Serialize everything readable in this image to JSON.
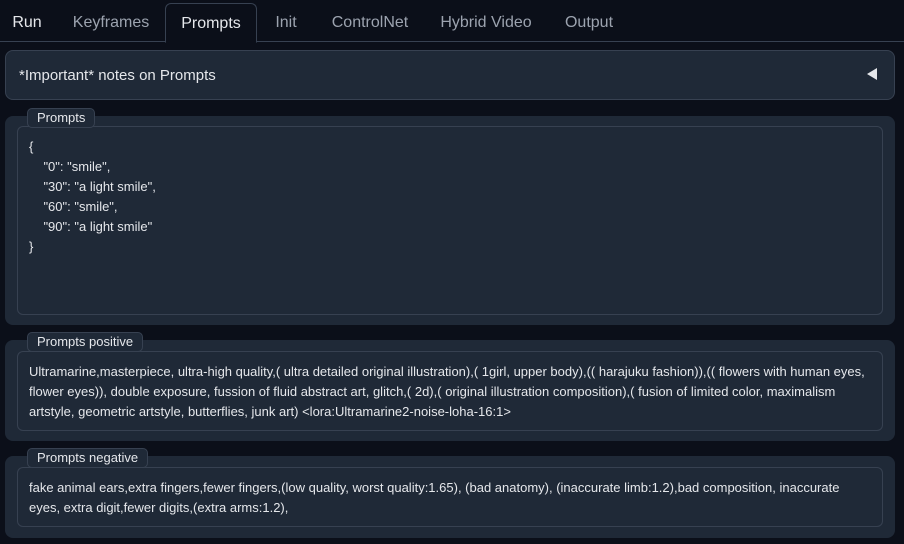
{
  "tabs": [
    {
      "label": "Run"
    },
    {
      "label": "Keyframes"
    },
    {
      "label": "Prompts",
      "selected": true
    },
    {
      "label": "Init"
    },
    {
      "label": "ControlNet"
    },
    {
      "label": "Hybrid Video"
    },
    {
      "label": "Output"
    }
  ],
  "accordion": {
    "label": "*Important* notes on Prompts",
    "icon": "triangle-left-icon"
  },
  "prompts": {
    "label": "Prompts",
    "lines": [
      "{",
      "    \"0\": \"smile\",",
      "    \"30\": \"a light smile\",",
      "    \"60\": \"smile\",",
      "    \"90\": \"a light smile\"",
      "}"
    ]
  },
  "prompts_positive": {
    "label": "Prompts positive",
    "value": "Ultramarine,masterpiece, ultra-high quality,( ultra detailed original illustration),( 1girl, upper body),(( harajuku fashion)),(( flowers with human eyes, flower eyes)), double exposure, fussion of fluid abstract art, glitch,( 2d),( original illustration composition),( fusion of limited color, maximalism artstyle, geometric artstyle, butterflies, junk art) <lora:Ultramarine2-noise-loha-16:1>"
  },
  "prompts_negative": {
    "label": "Prompts negative",
    "value": "fake animal ears,extra fingers,fewer fingers,(low quality, worst quality:1.65), (bad anatomy), (inaccurate limb:1.2),bad composition, inaccurate eyes, extra digit,fewer digits,(extra arms:1.2),"
  }
}
